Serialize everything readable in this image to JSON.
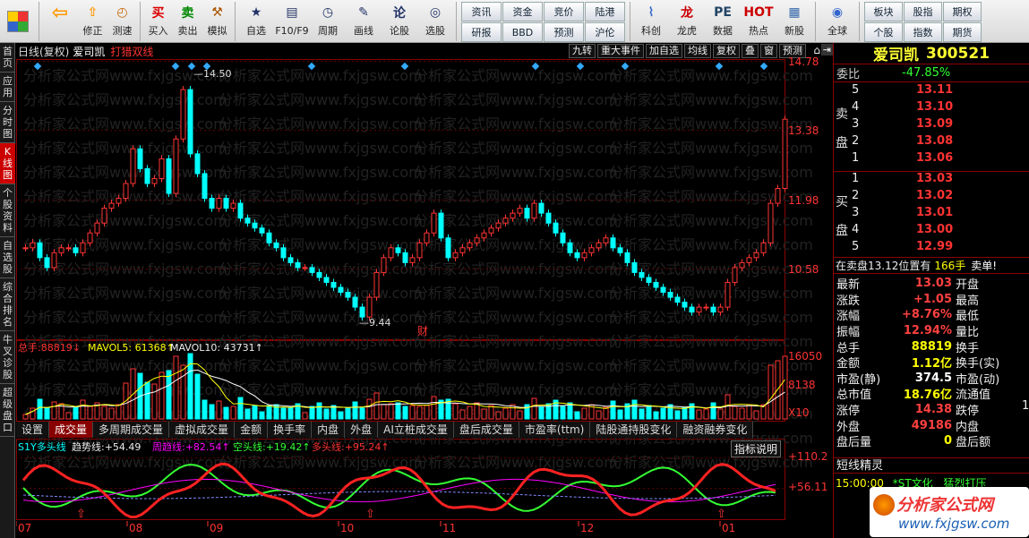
{
  "toolbar": {
    "btns1": [
      {
        "name": "back-button",
        "icon": "arrow-left-icon",
        "label": ""
      },
      {
        "name": "modify-button",
        "icon": "up-icon",
        "label": "修正"
      },
      {
        "name": "test-button",
        "icon": "clock-icon",
        "label": "测速"
      }
    ],
    "btns2": [
      {
        "name": "buy-button",
        "icon": "buy-icon",
        "glyph": "买",
        "label": "买入"
      },
      {
        "name": "sell-button",
        "icon": "sell-icon",
        "glyph": "卖",
        "label": "卖出"
      },
      {
        "name": "simulate-button",
        "icon": "hammer-icon",
        "glyph": "⚒",
        "label": "模拟"
      }
    ],
    "btns3": [
      {
        "name": "self-select-button",
        "icon": "star-icon",
        "glyph": "★",
        "label": "自选"
      },
      {
        "name": "f10-button",
        "icon": "window-icon",
        "glyph": "▤",
        "label": "F10/F9"
      },
      {
        "name": "period-button",
        "icon": "cycle-icon",
        "glyph": "◷",
        "label": "周期"
      },
      {
        "name": "draw-button",
        "icon": "pencil-icon",
        "glyph": "✎",
        "label": "画线"
      },
      {
        "name": "forum-button",
        "icon": "forum-icon",
        "glyph": "论",
        "label": "论股"
      },
      {
        "name": "select-stock-button",
        "icon": "scan-icon",
        "glyph": "◎",
        "label": "选股"
      }
    ],
    "grid1": [
      "资讯",
      "资金",
      "竞价",
      "陆港",
      "研报",
      "BBD",
      "预测",
      "沪伦"
    ],
    "btns4": [
      {
        "name": "kechuang-button",
        "icon": "chart-icon",
        "glyph": "⌇",
        "label": "科创"
      },
      {
        "name": "longhu-button",
        "icon": "dragon-icon",
        "glyph": "龙",
        "label": "龙虎"
      },
      {
        "name": "data-button",
        "icon": "pe-icon",
        "glyph": "PE",
        "label": "数据"
      },
      {
        "name": "hot-button",
        "icon": "hot-icon",
        "glyph": "HOT",
        "label": "热点"
      },
      {
        "name": "newstock-button",
        "icon": "grid-icon",
        "glyph": "▦",
        "label": "新股"
      }
    ],
    "global": {
      "glyph": "◉",
      "label": "全球"
    },
    "grid2": [
      "板块",
      "股指",
      "期权",
      "个股",
      "指数",
      "期货"
    ]
  },
  "leftbar": [
    {
      "label": "首页",
      "act": false
    },
    {
      "label": "应用",
      "act": false
    },
    {
      "label": "分时图",
      "act": false
    },
    {
      "label": "K线图",
      "act": true
    },
    {
      "label": "个股资料",
      "act": false
    },
    {
      "label": "自选股",
      "act": false
    },
    {
      "label": "综合排名",
      "act": false
    },
    {
      "label": "牛叉诊股",
      "act": false
    },
    {
      "label": "超级盘口",
      "act": false
    }
  ],
  "chart": {
    "head_left": "日线(复权)",
    "stock_name": "爱司凯",
    "strategy": "打猎双线",
    "head_btns": [
      "九转",
      "重大事件",
      "加自选",
      "均线",
      "复权",
      "叠",
      "窗",
      "预测"
    ],
    "price_axis": [
      "14.78",
      "13.38",
      "11.98",
      "10.58"
    ],
    "high_label": "14.50",
    "low_label": "9.44",
    "cai_label": "财",
    "vol_legend": {
      "total_lbl": "总手:",
      "total": "88819",
      "ma5_lbl": "MAVOL5:",
      "ma5": "61368",
      "ma10_lbl": "MAVOL10:",
      "ma10": "43731"
    },
    "vol_axis": [
      "16050",
      "8138",
      "X10"
    ],
    "tabs": [
      "设置",
      "成交量",
      "多周期成交量",
      "虚拟成交量",
      "金额",
      "换手率",
      "内盘",
      "外盘",
      "AI立桩成交量",
      "盘后成交量",
      "市盈率(ttm)",
      "陆股通持股变化",
      "融资融券变化"
    ],
    "indicator_help": "指标说明",
    "ind_legend": {
      "s1": "S1Y多头线",
      "trend_lbl": "趋势线:",
      "trend": "+54.49",
      "week_lbl": "周趋线:",
      "week": "+82.54",
      "short_lbl": "空头线:",
      "short": "+19.42",
      "long_lbl": "多头线:",
      "long": "+95.24"
    },
    "ind_axis": [
      "+110.2",
      "+56.11"
    ],
    "months": [
      "07",
      "08",
      "09",
      "10",
      "11",
      "12",
      "01"
    ],
    "watermark": "分析家公式网www.fxjgsw.com"
  },
  "right": {
    "name": "爱司凯",
    "code": "300521",
    "weibi_lbl": "委比",
    "weibi": "-47.85%",
    "sell_lbl": "卖盘",
    "asks": [
      {
        "n": "5",
        "p": "13.11"
      },
      {
        "n": "4",
        "p": "13.10"
      },
      {
        "n": "3",
        "p": "13.09"
      },
      {
        "n": "2",
        "p": "13.08"
      },
      {
        "n": "1",
        "p": "13.06"
      }
    ],
    "buy_lbl": "买盘",
    "bids": [
      {
        "n": "1",
        "p": "13.03"
      },
      {
        "n": "2",
        "p": "13.02"
      },
      {
        "n": "3",
        "p": "13.01"
      },
      {
        "n": "4",
        "p": "13.00"
      },
      {
        "n": "5",
        "p": "12.99"
      }
    ],
    "notice": "在卖盘13.12位置有",
    "notice_qty": "166手",
    "notice_tag": "卖单!",
    "stats": [
      {
        "l": "最新",
        "v": "13.03",
        "c": "red",
        "r": "开盘"
      },
      {
        "l": "涨跌",
        "v": "+1.05",
        "c": "red",
        "r": "最高"
      },
      {
        "l": "涨幅",
        "v": "+8.76%",
        "c": "red",
        "r": "最低"
      },
      {
        "l": "振幅",
        "v": "12.94%",
        "c": "red",
        "r": "量比"
      },
      {
        "l": "总手",
        "v": "88819",
        "c": "yel",
        "r": "换手"
      },
      {
        "l": "金额",
        "v": "1.12亿",
        "c": "yel",
        "r": "换手(实)"
      },
      {
        "l": "市盈(静)",
        "v": "374.5",
        "c": "white",
        "r": "市盈(动)"
      },
      {
        "l": "总市值",
        "v": "18.76亿",
        "c": "yel",
        "r": "流通值"
      },
      {
        "l": "涨停",
        "v": "14.38",
        "c": "red",
        "r": "跌停"
      },
      {
        "l": "外盘",
        "v": "49186",
        "c": "red",
        "r": "内盘"
      },
      {
        "l": "盘后量",
        "v": "0",
        "c": "yel",
        "r": "盘后额"
      }
    ],
    "right_edge": "1",
    "sprite_title": "短线精灵",
    "sprite_time": "15:00:00",
    "sprite_stock": "*ST文化",
    "sprite_event": "猛烈打压",
    "logo_text": "分析家公式网",
    "logo_url": "www.fxjgsw.com"
  }
}
